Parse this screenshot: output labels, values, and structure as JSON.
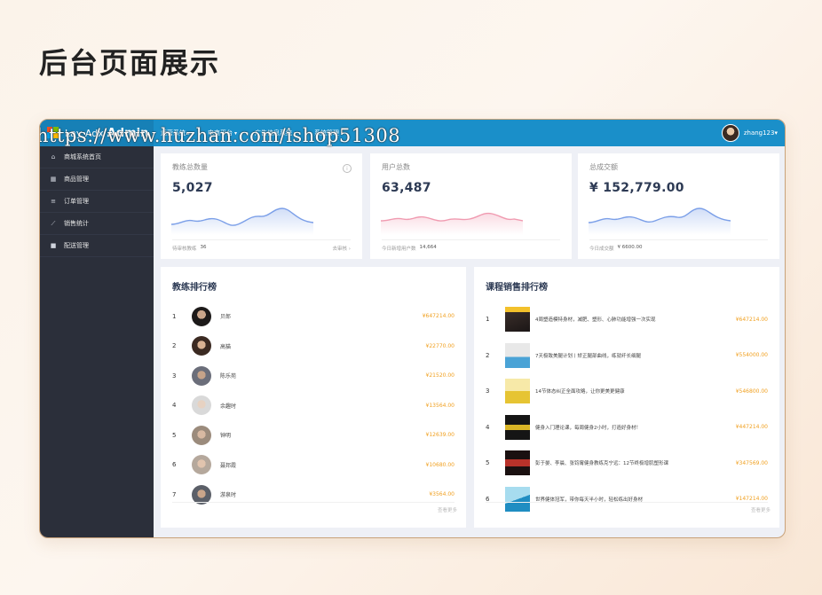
{
  "headline": "后台页面展示",
  "watermark": "https://www.huzhan.com/ishop51308",
  "topbar": {
    "brand_prefix": "Lay Adx",
    "brand": "Admin",
    "nav": [
      "运营系统",
      "电商平台",
      "广告信息系统",
      "系统管理"
    ],
    "user": "zhang123"
  },
  "sidebar": {
    "items": [
      {
        "label": "商城系统首页",
        "icon": "home-icon"
      },
      {
        "label": "商品管理",
        "icon": "grid-icon"
      },
      {
        "label": "订单管理",
        "icon": "list-icon"
      },
      {
        "label": "销售统计",
        "icon": "chart-icon"
      },
      {
        "label": "配送管理",
        "icon": "truck-icon"
      }
    ]
  },
  "stats": [
    {
      "label": "教练总数量",
      "value": "5,027",
      "foot_label": "待审核教练",
      "foot_value": "36",
      "more": "去审核",
      "color": "#7b9fe8"
    },
    {
      "label": "用户总数",
      "value": "63,487",
      "foot_label": "今日新增用户数",
      "foot_value": "14,664",
      "more": "",
      "color": "#f09ab0"
    },
    {
      "label": "总成交额",
      "value": "¥ 152,779.00",
      "foot_label": "今日成交额",
      "foot_value": "¥ 6600.00",
      "more": "",
      "color": "#7b9fe8"
    }
  ],
  "coach_rank": {
    "title": "教练排行榜",
    "more": "查看更多",
    "rows": [
      {
        "idx": "1",
        "name": "贝郎",
        "amount": "¥647214.00"
      },
      {
        "idx": "2",
        "name": "高猫",
        "amount": "¥22770.00"
      },
      {
        "idx": "3",
        "name": "陈乐苑",
        "amount": "¥21520.00"
      },
      {
        "idx": "4",
        "name": "余趣时",
        "amount": "¥13564.00"
      },
      {
        "idx": "5",
        "name": "钟明",
        "amount": "¥12639.00"
      },
      {
        "idx": "6",
        "name": "聂邦霞",
        "amount": "¥10680.00"
      },
      {
        "idx": "7",
        "name": "游泉时",
        "amount": "¥3564.00"
      }
    ]
  },
  "course_rank": {
    "title": "课程销售排行榜",
    "more": "查看更多",
    "rows": [
      {
        "idx": "1",
        "name": "4周塑造模特身材，减肥、塑形、心肺功能增强一次实现",
        "amount": "¥647214.00"
      },
      {
        "idx": "2",
        "name": "7天极致美腿计划丨矫正腿部曲线，练就纤长细腿",
        "amount": "¥554000.00"
      },
      {
        "idx": "3",
        "name": "14节体态纠正全面攻略，让你更美更健康",
        "amount": "¥546800.00"
      },
      {
        "idx": "4",
        "name": "健身入门理论课，每周健身2小时，打造好身材！",
        "amount": "¥447214.00"
      },
      {
        "idx": "5",
        "name": "彭于晏、李晨、张钧甯健身教练克宁远：12节终极增肌塑形课",
        "amount": "¥347569.00"
      },
      {
        "idx": "6",
        "name": "世界健体冠军，带你每天半小时，轻松练出好身材",
        "amount": "¥147214.00"
      }
    ]
  }
}
